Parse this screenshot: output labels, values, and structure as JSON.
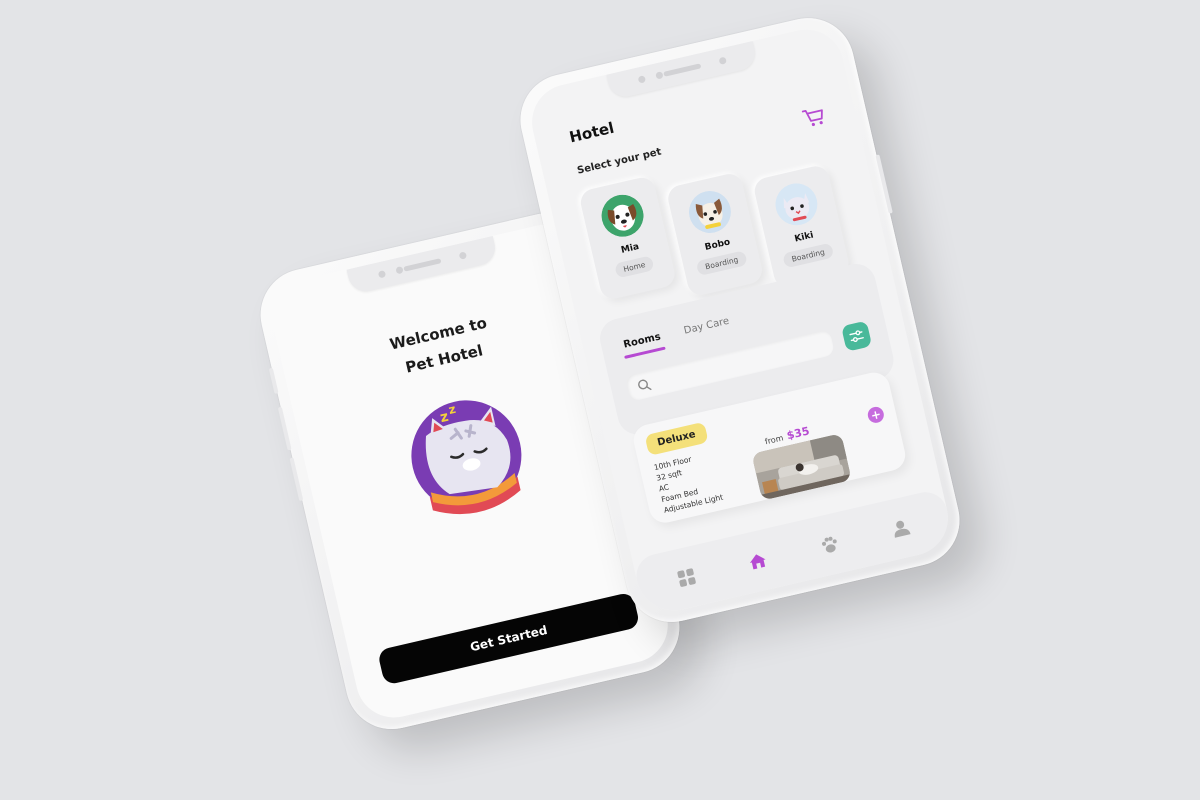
{
  "welcome": {
    "title_line1": "Welcome to",
    "title_line2": "Pet Hotel",
    "cta_label": "Get Started"
  },
  "hotel": {
    "title": "Hotel",
    "select_label": "Select your pet",
    "pets": [
      {
        "name": "Mia",
        "tag": "Home"
      },
      {
        "name": "Bobo",
        "tag": "Boarding"
      },
      {
        "name": "Kiki",
        "tag": "Boarding"
      }
    ],
    "tabs": [
      {
        "label": "Rooms",
        "active": true
      },
      {
        "label": "Day Care",
        "active": false
      }
    ],
    "room": {
      "badge": "Deluxe",
      "features": [
        "10th Floor",
        "32 sqft",
        "AC",
        "Foam Bed",
        "Adjustable Light"
      ],
      "price_prefix": "from",
      "price": "$35"
    },
    "nav": [
      "grid-icon",
      "home-icon",
      "paw-icon",
      "user-icon"
    ]
  },
  "colors": {
    "accent": "#b64ad2",
    "badge": "#f4e07a",
    "filter": "#49b99a",
    "background": "#e3e4e7"
  }
}
